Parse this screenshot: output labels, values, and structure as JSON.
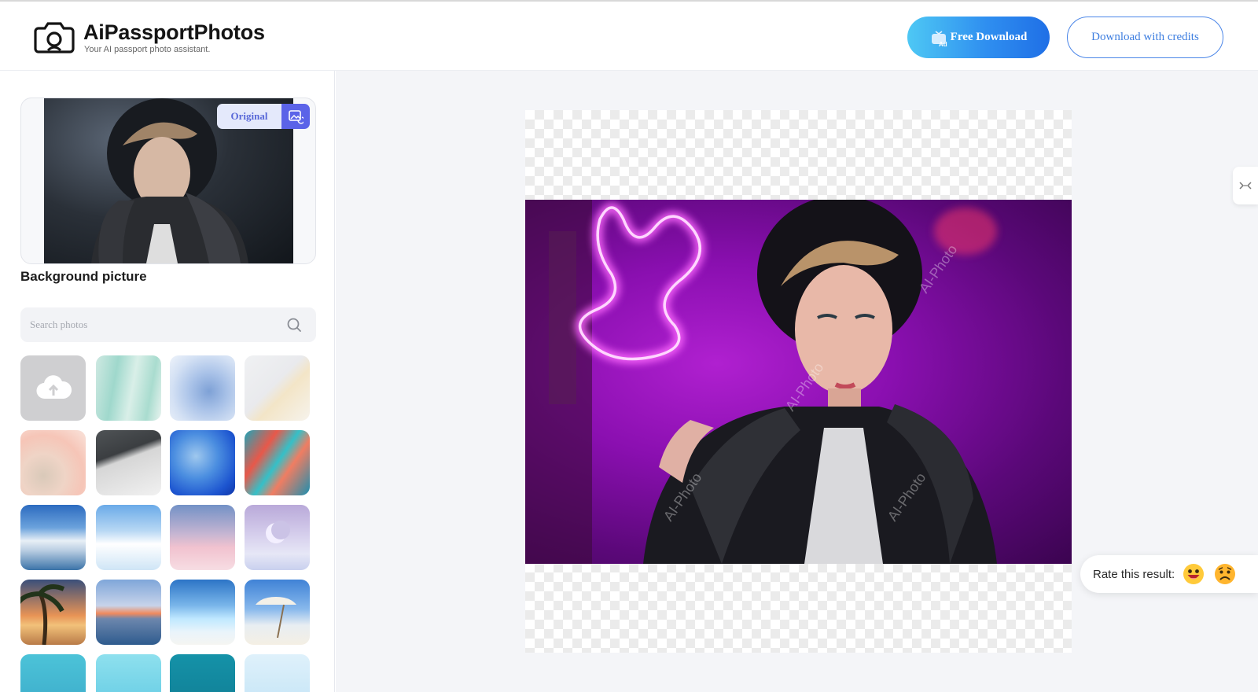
{
  "header": {
    "brand_name": "AiPassportPhotos",
    "brand_tagline": "Your AI passport photo assistant.",
    "free_download_label": "Free Download",
    "ad_badge": "Ad",
    "credits_download_label": "Download with credits",
    "accent_color": "#2f8ff0"
  },
  "sidebar": {
    "original_badge_label": "Original",
    "section_title": "Background picture",
    "search": {
      "placeholder": "Search photos",
      "value": ""
    },
    "upload_tile_icon": "cloud-upload-icon",
    "background_tiles": [
      "mint-watercolor",
      "blue-watercolor",
      "beige-abstract",
      "peach-clouds",
      "gray-brush",
      "blue-ink",
      "coral-teal-paint",
      "sky-clouds",
      "rainbow-sky",
      "pink-clouds",
      "crescent-moon",
      "palm-sunset",
      "ocean-sunset",
      "glowing-shore",
      "beach-umbrella",
      "sea-waves",
      "aqua-gradient",
      "teal-solid",
      "light-sky"
    ]
  },
  "canvas": {
    "watermark": "AI-Photo"
  },
  "rating": {
    "label": "Rate this result:",
    "options": [
      "happy-emoji-icon",
      "sad-emoji-icon"
    ]
  },
  "side_toggle_icon": "collapse-icon"
}
